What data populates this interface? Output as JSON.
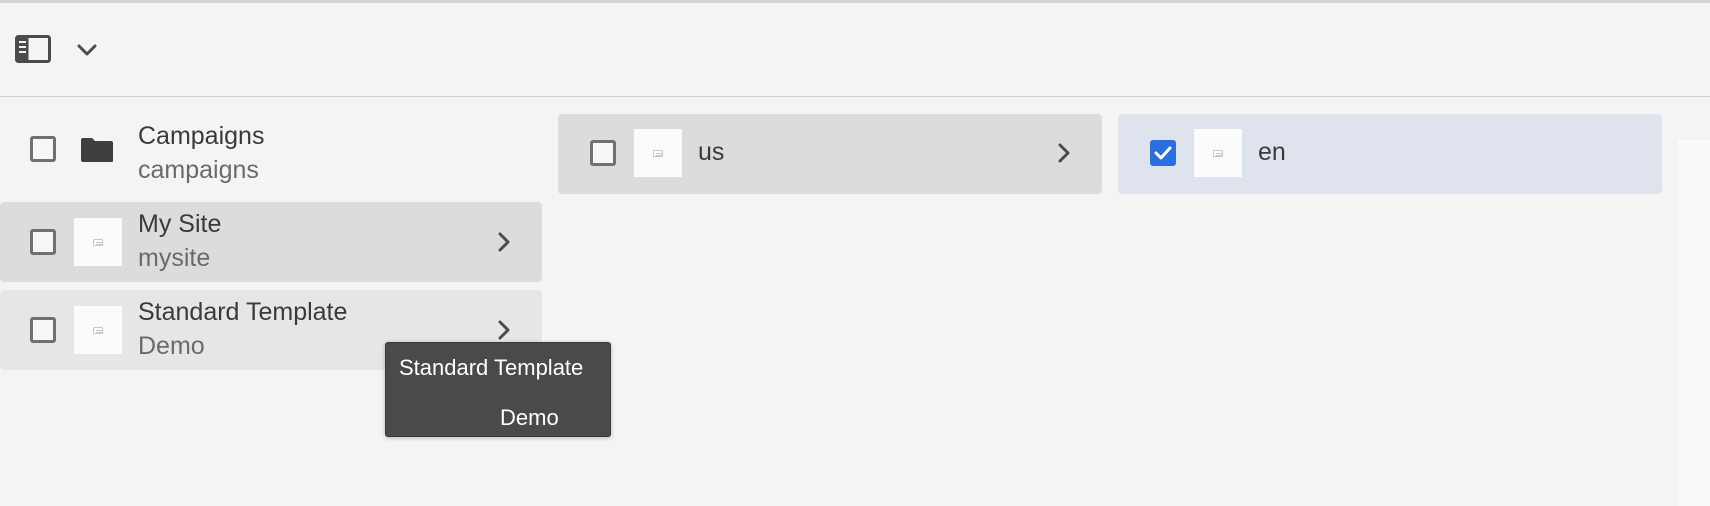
{
  "toolbar": {
    "rail_toggle_icon": "rail-toggle-icon",
    "rail_menu_icon": "chevron-down-icon"
  },
  "columns": [
    {
      "items": [
        {
          "title": "Campaigns",
          "subtitle": "campaigns",
          "icon": "folder-icon",
          "checked": false,
          "has_children": false
        },
        {
          "title": "My Site",
          "subtitle": "mysite",
          "icon": "page-thumbnail",
          "checked": false,
          "has_children": true
        },
        {
          "title": "Standard Template",
          "subtitle": "Demo",
          "icon": "page-thumbnail",
          "checked": false,
          "has_children": true
        }
      ]
    },
    {
      "items": [
        {
          "title": "us",
          "icon": "page-thumbnail",
          "checked": false,
          "has_children": true
        }
      ]
    },
    {
      "items": [
        {
          "title": "en",
          "icon": "page-thumbnail",
          "checked": true,
          "has_children": false
        }
      ]
    }
  ],
  "tooltip": {
    "line1": "Standard Template",
    "line2": "Demo"
  },
  "colors": {
    "background": "#f4f4f4",
    "selected_path": "#dcdcdc",
    "checked_row": "#dee3ee",
    "checkbox_checked": "#2a6ee0",
    "tooltip_bg": "#4a4a4a"
  }
}
